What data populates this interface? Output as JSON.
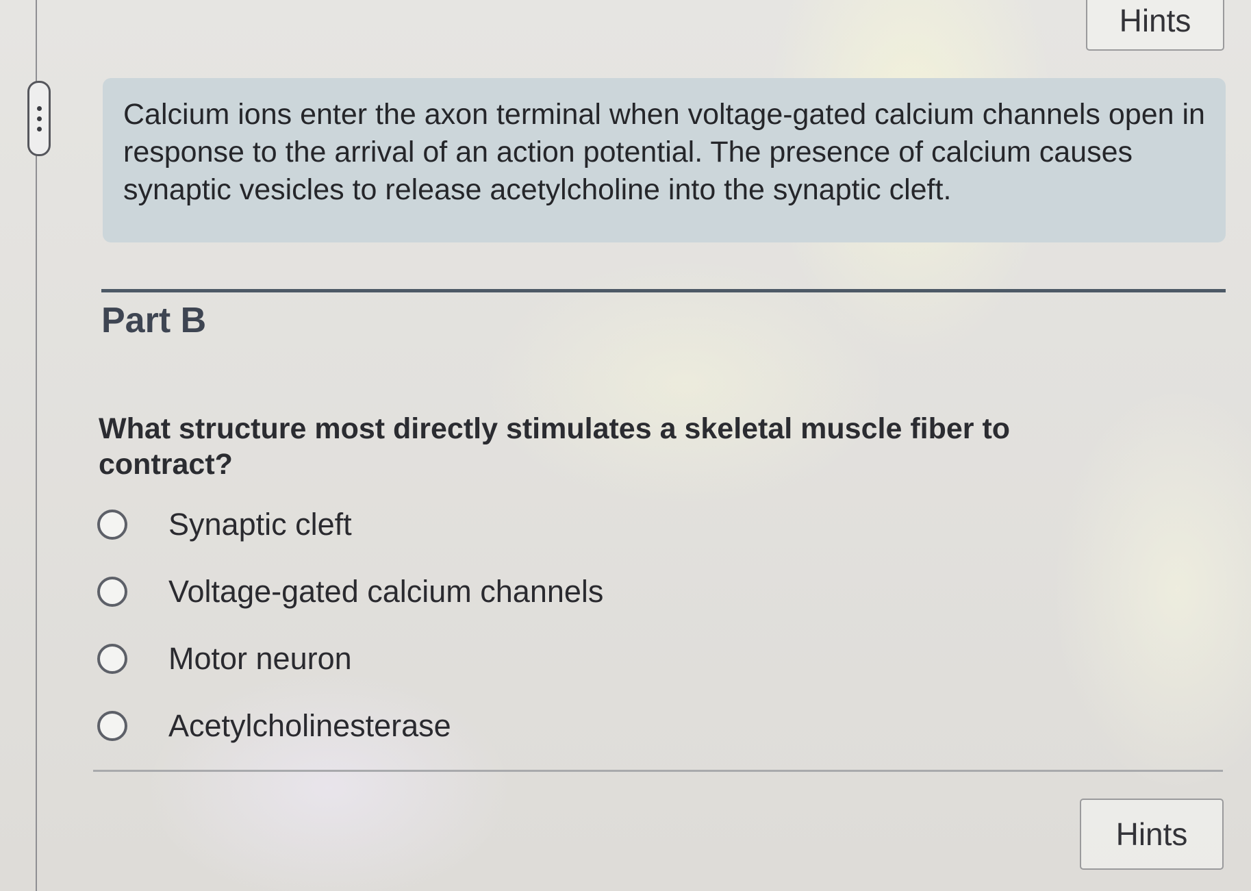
{
  "header": {
    "hints_label": "Hints"
  },
  "sidebar": {
    "handle_icon": "more-vertical-icon"
  },
  "context": {
    "text": "Calcium ions enter the axon terminal when voltage-gated calcium channels open in response to the arrival of an action potential. The presence of calcium causes synaptic vesicles to release acetylcholine into the synaptic cleft."
  },
  "part": {
    "title": "Part B",
    "question": "What structure most directly stimulates a skeletal muscle fiber to contract?",
    "options": [
      {
        "label": "Synaptic cleft",
        "selected": false
      },
      {
        "label": "Voltage-gated calcium channels",
        "selected": false
      },
      {
        "label": "Motor neuron",
        "selected": false
      },
      {
        "label": "Acetylcholinesterase",
        "selected": false
      }
    ]
  },
  "footer": {
    "hints_label": "Hints"
  },
  "colors": {
    "context_background": "#ccd6da",
    "divider": "#4d5966",
    "part_title": "#3e4552"
  }
}
